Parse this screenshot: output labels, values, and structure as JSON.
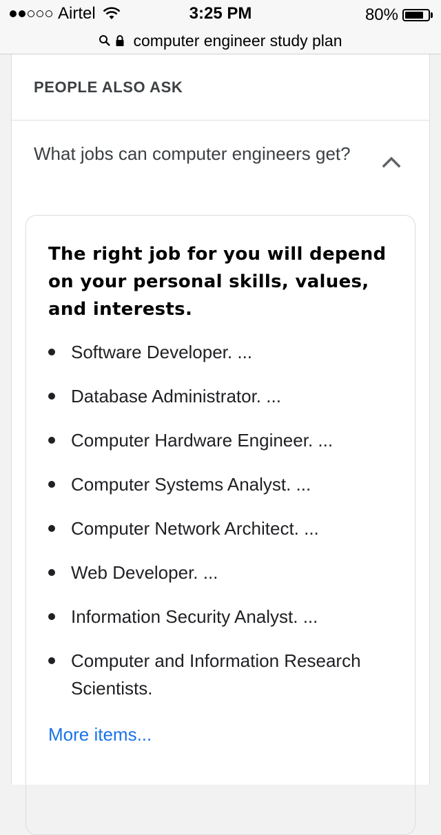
{
  "status_bar": {
    "carrier": "Airtel",
    "signal_bars_filled": 2,
    "signal_bars_total": 5,
    "time": "3:25 PM",
    "battery_percent": "80%",
    "battery_level": 0.8
  },
  "url_bar": {
    "query": "computer engineer study plan"
  },
  "paa": {
    "header": "PEOPLE ALSO ASK",
    "question": "What jobs can computer engineers get?",
    "answer": {
      "headline": "The right job for you will depend on your personal skills, values, and interests.",
      "items": [
        "Software Developer. ...",
        "Database Administrator. ...",
        "Computer Hardware Engineer. ...",
        "Computer Systems Analyst. ...",
        "Computer Network Architect. ...",
        "Web Developer. ...",
        "Information Security Analyst. ...",
        "Computer and Information Research Scientists."
      ],
      "more_link": "More items..."
    }
  },
  "colors": {
    "link": "#1a73e8",
    "text": "#202124",
    "border": "#dadce0"
  }
}
